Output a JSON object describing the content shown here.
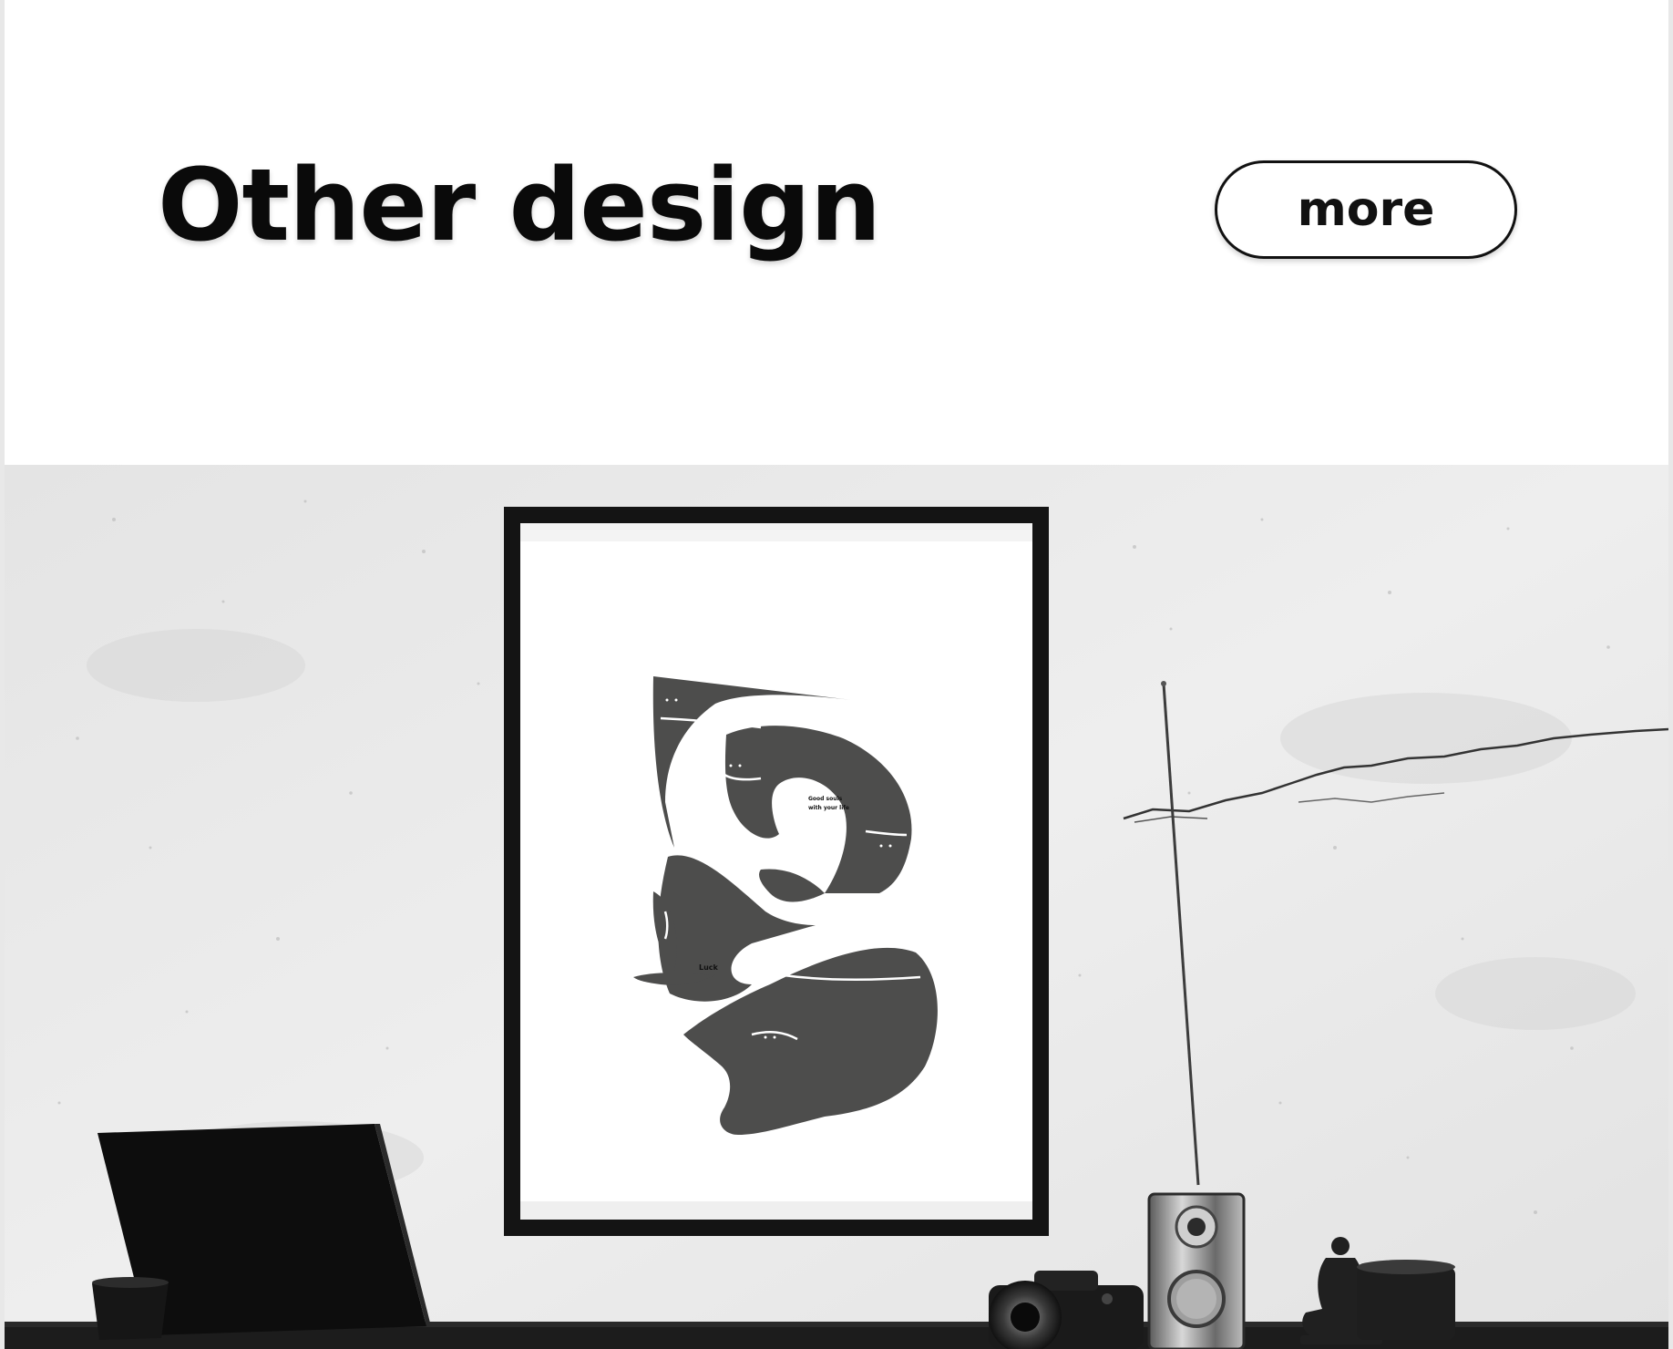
{
  "section": {
    "title": "Other design",
    "more_label": "more"
  },
  "poster": {
    "caption_line1": "Good souls",
    "caption_line2": "with your life",
    "signature": "Luck"
  },
  "colors": {
    "wall": "#e9e9e9",
    "poster_shape": "#4d4d4c",
    "frame": "#141414",
    "desk": "#1c1c1c"
  }
}
